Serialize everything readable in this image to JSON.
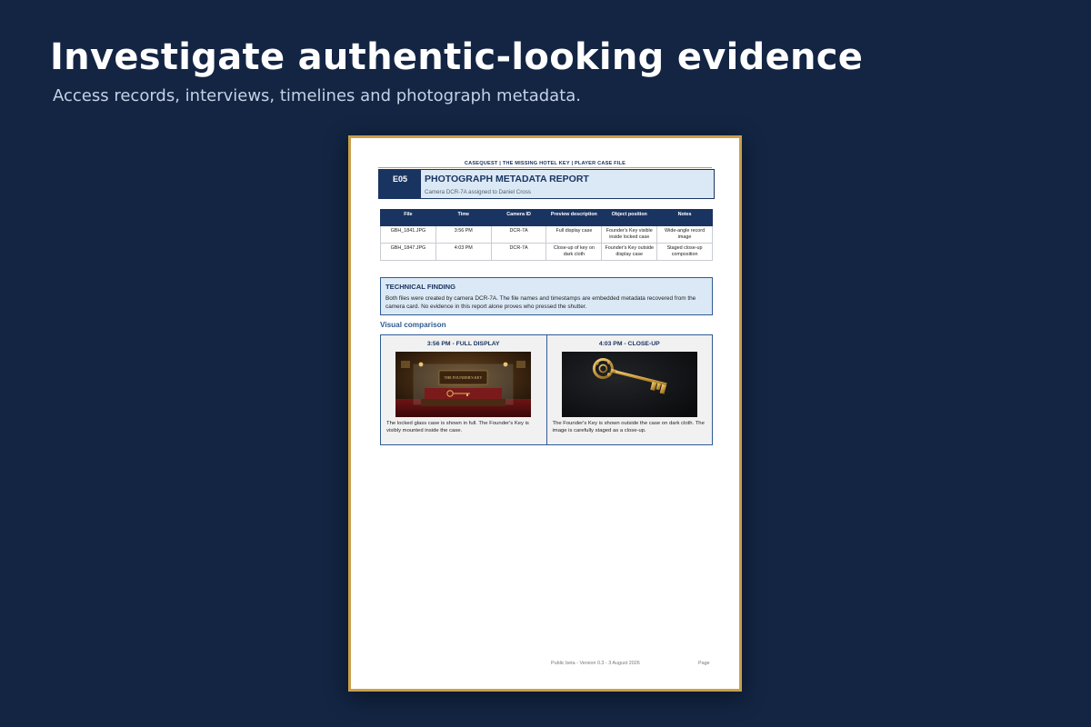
{
  "hero": {
    "headline": "Investigate authentic-looking evidence",
    "subline": "Access records, interviews, timelines and photograph metadata."
  },
  "document": {
    "running_head": "CASEQUEST  |  THE MISSING HOTEL KEY  |  PLAYER CASE FILE",
    "code": "E05",
    "title": "PHOTOGRAPH METADATA REPORT",
    "subtitle": "Camera DCR-7A assigned to Daniel Cross",
    "table": {
      "headers": [
        "File",
        "Time",
        "Camera ID",
        "Preview description",
        "Object position",
        "Notes"
      ],
      "rows": [
        [
          "GBH_1841.JPG",
          "3:56 PM",
          "DCR-7A",
          "Full display case",
          "Founder's Key visible inside locked case",
          "Wide-angle record image"
        ],
        [
          "GBH_1847.JPG",
          "4:03 PM",
          "DCR-7A",
          "Close-up of key on dark cloth",
          "Founder's Key outside display case",
          "Staged close-up composition"
        ]
      ]
    },
    "finding": {
      "title": "TECHNICAL FINDING",
      "text": "Both files were created by camera DCR-7A. The file names and timestamps are embedded metadata recovered from the camera card. No evidence in this report alone proves who pressed the shutter."
    },
    "comparison": {
      "heading": "Visual comparison",
      "left": {
        "title": "3:56 PM - FULL DISPLAY",
        "plaque": "THE FOUNDER'S KEY",
        "caption": "The locked glass case is shown in full. The Founder's Key is visibly mounted inside the case."
      },
      "right": {
        "title": "4:03 PM - CLOSE-UP",
        "caption": "The Founder's Key is shown outside the case on dark cloth. The image is carefully staged as a close-up."
      }
    },
    "footer": {
      "version": "Public beta - Version 0.3 - 3 August 2026",
      "page": "Page"
    }
  },
  "colors": {
    "background": "#132543",
    "navy": "#1a3461",
    "gold": "#c9a04a",
    "light_blue": "#dbe9f6"
  }
}
